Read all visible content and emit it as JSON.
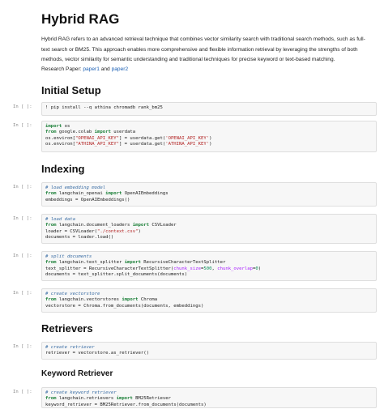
{
  "notebook": {
    "title": "Hybrid RAG",
    "intro": "Hybrid RAG refers to an advanced retrieval technique that combines vector similarity search with traditional search methods, such as full-text search or BM25. This approach enables more comprehensive and flexible information retrieval by leveraging the strengths of both methods, vector similarity for semantic understanding and traditional techniques for precise keyword or text-based matching.",
    "research_prefix": "Research Paper:",
    "paper1": "paper1",
    "and_word": "and",
    "paper2": "paper2",
    "sections": {
      "setup": "Initial Setup",
      "indexing": "Indexing",
      "retrievers": "Retrievers",
      "keyword": "Keyword Retriever"
    },
    "prompt": "In [ ]:"
  },
  "cells": {
    "c1": {
      "l1": "! pip install --q athina chromadb rank_bm25"
    },
    "c2": {
      "l1a": "import",
      "l1b": " os",
      "l2a": "from",
      "l2b": " google.colab ",
      "l2c": "import",
      "l2d": " userdata",
      "l3a": "os.environ[",
      "l3b": "\"OPENAI_API_KEY\"",
      "l3c": "] = userdata.get(",
      "l3d": "'OPENAI_API_KEY'",
      "l3e": ")",
      "l4a": "os.environ[",
      "l4b": "\"ATHINA_API_KEY\"",
      "l4c": "] = userdata.get(",
      "l4d": "'ATHINA_API_KEY'",
      "l4e": ")"
    },
    "c3": {
      "l1": "# load embedding model",
      "l2a": "from",
      "l2b": " langchain_openai ",
      "l2c": "import",
      "l2d": " OpenAIEmbeddings",
      "l3": "embeddings = OpenAIEmbeddings()"
    },
    "c4": {
      "l1": "# load data",
      "l2a": "from",
      "l2b": " langchain.document_loaders ",
      "l2c": "import",
      "l2d": " CSVLoader",
      "l3a": "loader = CSVLoader(",
      "l3b": "\"./context.csv\"",
      "l3c": ")",
      "l4": "documents = loader.load()"
    },
    "c5": {
      "l1": "# split documents",
      "l2a": "from",
      "l2b": " langchain.text_splitter ",
      "l2c": "import",
      "l2d": " RecursiveCharacterTextSplitter",
      "l3a": "text_splitter = RecursiveCharacterTextSplitter(",
      "l3b": "chunk_size",
      "l3c": "=",
      "l3d": "500",
      "l3e": ", ",
      "l3f": "chunk_overlap",
      "l3g": "=",
      "l3h": "0",
      "l3i": ")",
      "l4": "documents = text_splitter.split_documents(documents)"
    },
    "c6": {
      "l1": "# create vectorstore",
      "l2a": "from",
      "l2b": " langchain.vectorstores ",
      "l2c": "import",
      "l2d": " Chroma",
      "l3": "vectorstore = Chroma.from_documents(documents, embeddings)"
    },
    "c7": {
      "l1": "# create retriever",
      "l2": "retriever = vectorstore.as_retriever()"
    },
    "c8": {
      "l1": "# create keyword retriever",
      "l2a": "from",
      "l2b": " langchain.retrievers ",
      "l2c": "import",
      "l2d": " BM25Retriever",
      "l3": "keyword_retriever = BM25Retriever.from_documents(documents)"
    }
  },
  "colors": {
    "keyword": "#1a7f37",
    "string": "#b22222",
    "comment": "#3b6ea5",
    "link": "#1a5fb4",
    "cell_bg": "#f7f7f7"
  }
}
